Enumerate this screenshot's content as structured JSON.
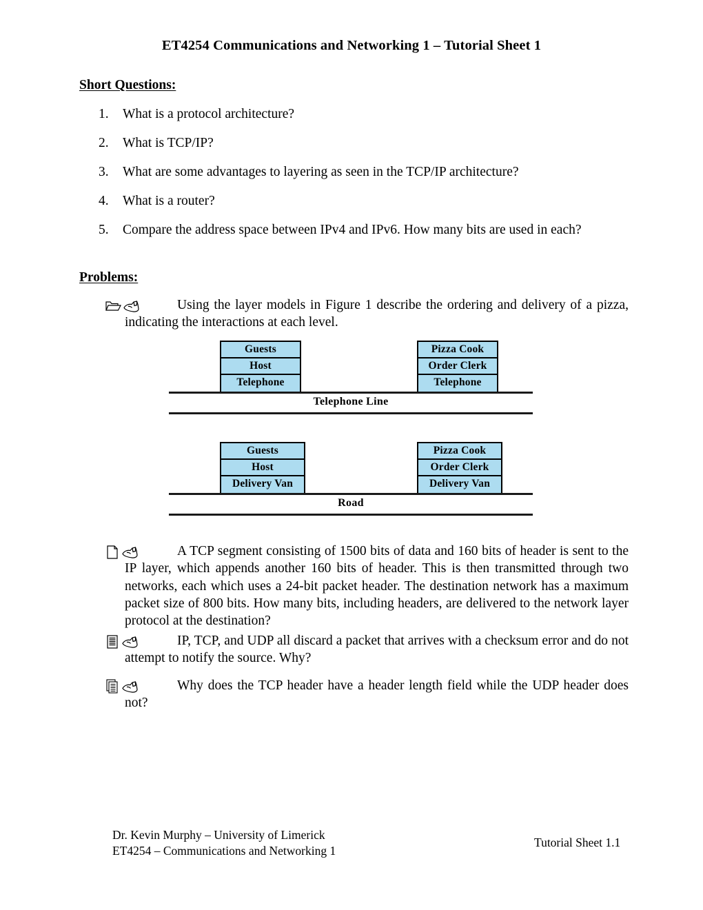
{
  "document": {
    "title": "ET4254 Communications and Networking 1 – Tutorial Sheet 1",
    "sections": {
      "short_questions_heading": "Short Questions:",
      "problems_heading": "Problems:"
    }
  },
  "short_questions": [
    {
      "number": "1.",
      "text": "What is a protocol architecture?"
    },
    {
      "number": "2.",
      "text": "What is TCP/IP?"
    },
    {
      "number": "3.",
      "text": "What are some advantages to layering as seen in the TCP/IP architecture?"
    },
    {
      "number": "4.",
      "text": "What is a router?"
    },
    {
      "number": "5.",
      "text": "Compare the address space between IPv4 and IPv6. How many bits are used in each?"
    }
  ],
  "problems": [
    {
      "marker_icons": [
        "open-folder-icon",
        "pointing-hand-icon"
      ],
      "text": "Using the layer models in Figure 1 describe the ordering and delivery of a pizza, indicating the interactions at each level."
    },
    {
      "marker_icons": [
        "page-document-icon",
        "pointing-hand-icon"
      ],
      "text": "A TCP segment consisting of 1500 bits of data and 160 bits of header is sent to the IP layer, which appends another 160 bits of header. This is then transmitted through two networks, each which uses a 24-bit packet header. The destination network has a maximum packet size of 800 bits. How many bits, including headers, are delivered to the network layer protocol at the destination?"
    },
    {
      "marker_icons": [
        "lined-document-icon",
        "pointing-hand-icon"
      ],
      "text": "IP, TCP, and UDP all discard a packet that arrives with a checksum error and do not attempt to notify the source. Why?"
    },
    {
      "marker_icons": [
        "stacked-documents-icon",
        "pointing-hand-icon"
      ],
      "text": "Why does the TCP header have a header length field while the UDP header does not?"
    }
  ],
  "figure": {
    "box_fill_color": "#ADDCF0",
    "box_border_color": "#000000",
    "diagrams": [
      {
        "left_stack": [
          "Guests",
          "Host",
          "Telephone"
        ],
        "right_stack": [
          "Pizza Cook",
          "Order Clerk",
          "Telephone"
        ],
        "medium_label": "Telephone Line"
      },
      {
        "left_stack": [
          "Guests",
          "Host",
          "Delivery Van"
        ],
        "right_stack": [
          "Pizza Cook",
          "Order Clerk",
          "Delivery Van"
        ],
        "medium_label": "Road"
      }
    ]
  },
  "footer": {
    "left_line_1": "Dr. Kevin Murphy – University of Limerick",
    "left_line_2": "ET4254 – Communications and Networking 1",
    "right": "Tutorial Sheet 1.1"
  }
}
